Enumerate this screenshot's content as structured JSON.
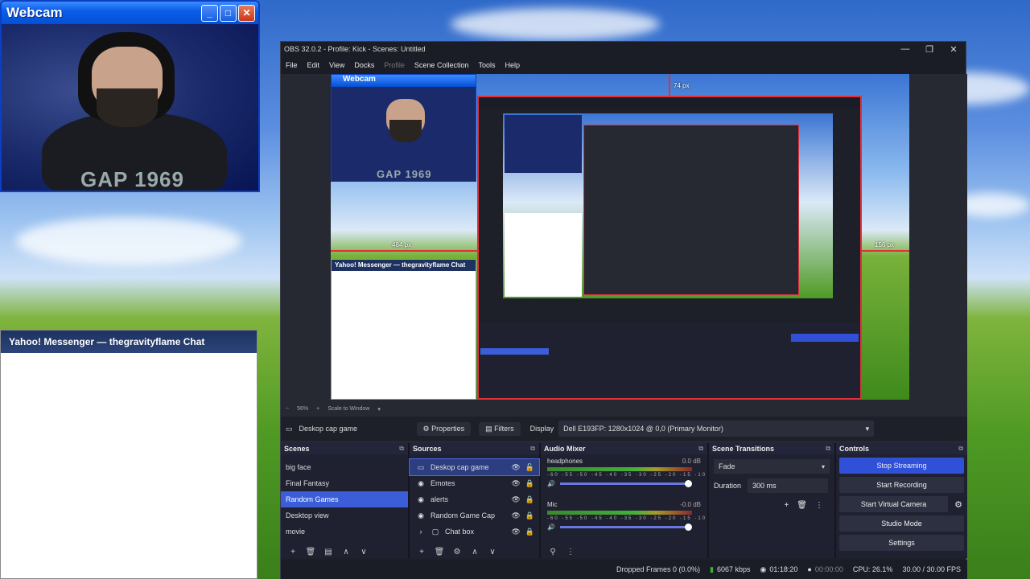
{
  "webcam_window": {
    "title": "Webcam",
    "shirt_text": "GAP 1969"
  },
  "chat_window": {
    "title": "Yahoo! Messenger — thegravityflame Chat"
  },
  "obs": {
    "window_title": "OBS 32.0.2 - Profile: Kick - Scenes: Untitled",
    "menu": [
      "File",
      "Edit",
      "View",
      "Docks",
      "Profile",
      "Scene Collection",
      "Tools",
      "Help"
    ],
    "preview": {
      "guide_labels": {
        "top": "74 px",
        "left": "484 px",
        "right": "156 px"
      },
      "embedded_webcam_title": "Webcam",
      "embedded_chat_title": "Yahoo! Messenger — thegravityflame Chat"
    },
    "zoom": {
      "level": "56%",
      "mode": "Scale to Window"
    },
    "source_bar": {
      "current_source": "Deskop cap game",
      "properties": "Properties",
      "filters": "Filters",
      "display_label": "Display",
      "display_value": "Dell E193FP: 1280x1024 @ 0,0 (Primary Monitor)"
    },
    "scenes": {
      "title": "Scenes",
      "items": [
        "big face",
        "Final Fantasy",
        "Random Games",
        "Desktop view",
        "movie"
      ],
      "selected": "Random Games"
    },
    "sources": {
      "title": "Sources",
      "items": [
        {
          "name": "Deskop cap game",
          "icon": "monitor-icon"
        },
        {
          "name": "Emotes",
          "icon": "browser-icon"
        },
        {
          "name": "alerts",
          "icon": "browser-icon"
        },
        {
          "name": "Random Game Cap",
          "icon": "browser-icon"
        },
        {
          "name": "Chat box",
          "icon": "folder-icon"
        }
      ]
    },
    "audio_mixer": {
      "title": "Audio Mixer",
      "channels": [
        {
          "name": "headphones",
          "db": "0.0 dB"
        },
        {
          "name": "Mic",
          "db": "-0.0 dB"
        }
      ],
      "ticks": "-60 -55 -50 -45 -40 -35 -30 -25 -20 -15 -10 -5 0"
    },
    "transitions": {
      "title": "Scene Transitions",
      "type": "Fade",
      "duration_label": "Duration",
      "duration_value": "300 ms"
    },
    "controls": {
      "title": "Controls",
      "buttons": [
        "Stop Streaming",
        "Start Recording",
        "Start Virtual Camera",
        "Studio Mode",
        "Settings"
      ]
    },
    "status": {
      "dropped": "Dropped Frames 0 (0.0%)",
      "kbps": "6067 kbps",
      "stream_time": "01:18:20",
      "rec_time": "00:00:00",
      "cpu": "CPU: 26.1%",
      "fps": "30.00 / 30.00 FPS"
    },
    "colors": {
      "accent": "#3150d8",
      "guide": "#e0303a"
    }
  }
}
